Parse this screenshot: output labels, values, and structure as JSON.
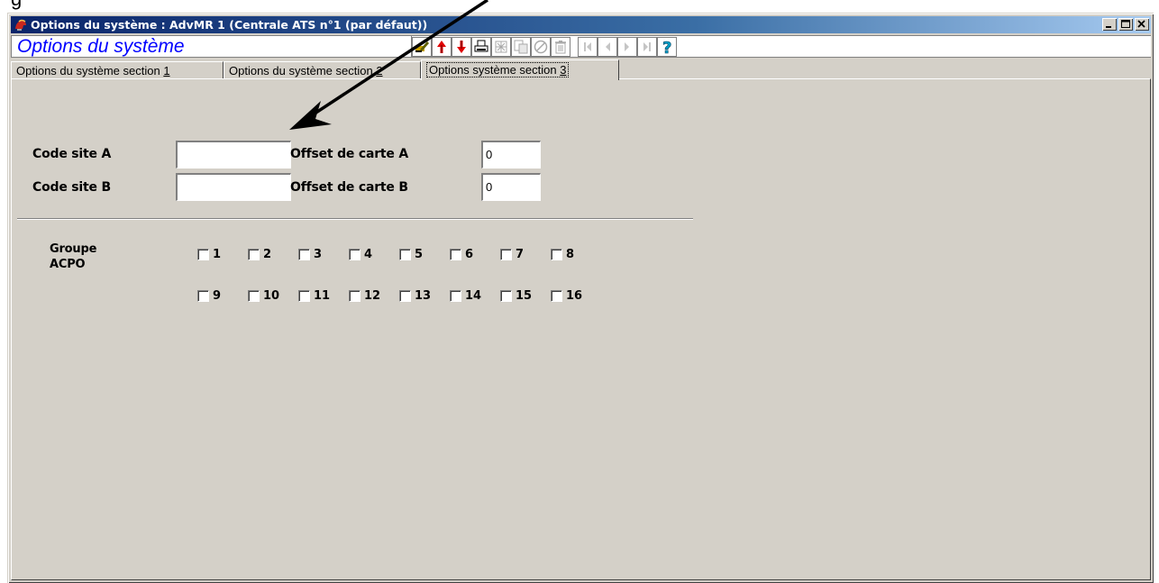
{
  "window": {
    "title": "Options du système : AdvMR 1 (Centrale ATS n°1 (par défaut))",
    "controls": [
      "_",
      "□",
      "X"
    ]
  },
  "header": {
    "panel_title": "Options du système",
    "toolbar_icons": [
      "edit-pencil-icon",
      "move-up-icon",
      "move-down-icon",
      "print-icon",
      "explode-icon",
      "copy-icon",
      "cancel-icon",
      "delete-icon",
      "first-record-icon",
      "previous-record-icon",
      "next-record-icon",
      "last-record-icon",
      "help-icon"
    ]
  },
  "tabs": [
    {
      "label": "Options du système section ",
      "hotkey": "1",
      "active": false
    },
    {
      "label": "Options du système section ",
      "hotkey": "2",
      "active": false
    },
    {
      "label": "Options système section ",
      "hotkey": "3",
      "active": true
    }
  ],
  "form": {
    "code_site_a_label": "Code site A",
    "code_site_a_value": "",
    "code_site_b_label": "Code site B",
    "code_site_b_value": "",
    "offset_a_label": "Offset de carte A",
    "offset_a_value": "0",
    "offset_b_label": "Offset de carte B",
    "offset_b_value": "0",
    "group_label_line1": "Groupe",
    "group_label_line2": "ACPO",
    "groups": [
      "1",
      "2",
      "3",
      "4",
      "5",
      "6",
      "7",
      "8",
      "9",
      "10",
      "11",
      "12",
      "13",
      "14",
      "15",
      "16"
    ]
  },
  "colors": {
    "title_gradient_start": "#0a246a",
    "panel_title_text": "#0000ff",
    "window_bg": "#d4d0c8",
    "arrow_up_red": "#e00000",
    "help_cyan": "#00a0c8"
  }
}
